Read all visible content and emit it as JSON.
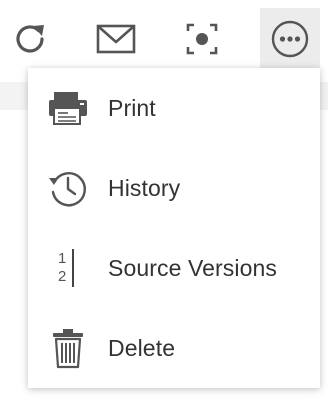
{
  "toolbar": {
    "buttons": [
      {
        "icon": "refresh-icon"
      },
      {
        "icon": "mail-icon"
      },
      {
        "icon": "focus-icon"
      },
      {
        "icon": "more-options-icon",
        "active": true
      }
    ]
  },
  "menu": {
    "items": [
      {
        "label": "Print",
        "icon": "print-icon"
      },
      {
        "label": "History",
        "icon": "history-icon"
      },
      {
        "label": "Source Versions",
        "icon": "source-versions-icon",
        "icon_numbers": [
          "1",
          "2"
        ]
      },
      {
        "label": "Delete",
        "icon": "trash-icon"
      }
    ]
  },
  "colors": {
    "icon": "#555555",
    "text": "#333333",
    "active_bg": "#ececec",
    "backdrop": "#f3f3f3"
  }
}
